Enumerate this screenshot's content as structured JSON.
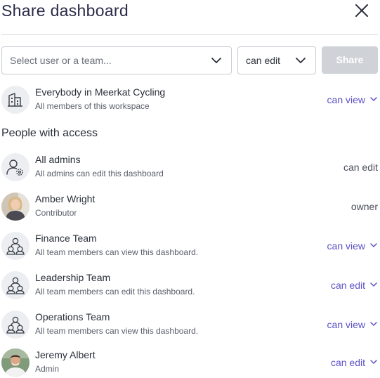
{
  "dialog": {
    "title": "Share dashboard",
    "close_icon": "close-icon"
  },
  "controls": {
    "user_select_placeholder": "Select user or a team...",
    "permission_value": "can edit",
    "share_label": "Share"
  },
  "everybody": {
    "name": "Everybody in Meerkat Cycling",
    "subtitle": "All members of this workspace",
    "permission": "can view",
    "icon": "building-icon"
  },
  "section_title": "People with access",
  "access": [
    {
      "name": "All admins",
      "subtitle": "All admins can edit this dashboard",
      "permission": "can edit",
      "editable": false,
      "avatar": "admin-gear-icon"
    },
    {
      "name": "Amber Wright",
      "subtitle": "Contributor",
      "permission": "owner",
      "editable": false,
      "avatar": "user-photo"
    },
    {
      "name": "Finance Team",
      "subtitle": "All team members can view this dashboard.",
      "permission": "can view",
      "editable": true,
      "avatar": "team-icon"
    },
    {
      "name": "Leadership Team",
      "subtitle": "All team members can edit this dashboard.",
      "permission": "can edit",
      "editable": true,
      "avatar": "team-icon"
    },
    {
      "name": "Operations Team",
      "subtitle": "All team members can view this dashboard.",
      "permission": "can view",
      "editable": true,
      "avatar": "team-icon"
    },
    {
      "name": "Jeremy Albert",
      "subtitle": "Admin",
      "permission": "can edit",
      "editable": true,
      "avatar": "user-photo"
    }
  ],
  "colors": {
    "accent": "#5b52c8",
    "title": "#2a2a4a",
    "share_disabled": "#cfd2d6",
    "avatar_bg": "#eceef1"
  }
}
